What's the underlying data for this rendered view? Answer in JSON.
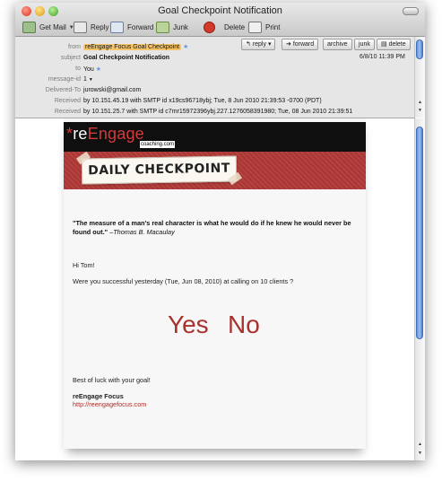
{
  "window": {
    "title": "Goal Checkpoint Notification"
  },
  "toolbar": {
    "get_mail": "Get Mail",
    "reply": "Reply",
    "forward": "Forward",
    "junk": "Junk",
    "delete": "Delete",
    "print": "Print"
  },
  "header": {
    "buttons": {
      "reply": "reply",
      "forward": "forward",
      "archive": "archive",
      "junk": "junk",
      "delete": "delete"
    },
    "labels": {
      "from": "from",
      "subject": "subject",
      "to": "to",
      "message_id": "message-id",
      "delivered_to": "Delivered-To",
      "received": "Received"
    },
    "from": "reEngage Focus Goal Checkpoint",
    "subject": "Goal Checkpoint Notification",
    "to": "You",
    "message_id": "1",
    "delivered_to": "jurowski@gmail.com",
    "received_1": "by 10.151.45.19 with SMTP id x19cs96718ybj; Tue, 8 Jun 2010 21:39:53 -0700 (PDT)",
    "received_2": "by 10.151.25.7 with SMTP id c7mr15972396ybj.227.1276058391980; Tue, 08 Jun 2010 21:39:51",
    "date": "6/8/10 11:39 PM"
  },
  "email": {
    "logo_asterisk": "*",
    "logo_re": "re",
    "logo_engage": "Engage",
    "logo_sub": "coaching.com",
    "banner": "DAILY CHECKPOINT",
    "quote": "\"The measure of a man's real character is what he would do if he knew he would never be found out.\"",
    "quote_author": "–Thomas B. Macaulay",
    "greeting": "Hi Tom!",
    "question": "Were you successful yesterday (Tue, Jun 08, 2010) at calling on 10 clients ?",
    "yes": "Yes",
    "no": "No",
    "closing": "Best of luck with your goal!",
    "signature": "reEngage Focus",
    "link": "http://reengagefocus.com"
  }
}
